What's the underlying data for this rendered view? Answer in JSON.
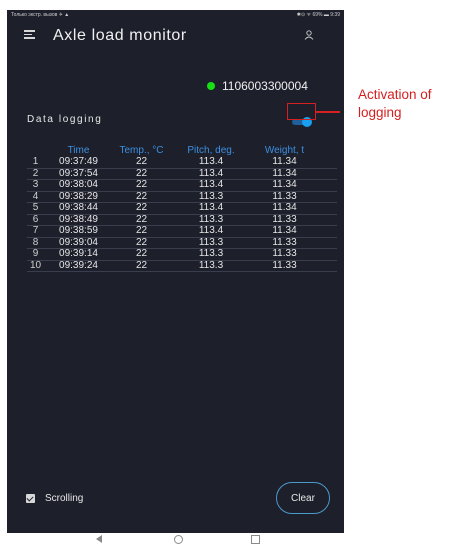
{
  "status_bar": {
    "left_text": "Только экстр. вызов ✈ ▲",
    "right_text": "✱⊙ ᯤ 69% ▬ 9:39"
  },
  "app_bar": {
    "title": "Axle load monitor",
    "menu_icon": "menu-icon",
    "user_icon": "user-icon"
  },
  "device": {
    "id": "1106003300004",
    "status_color": "#14e014"
  },
  "logging": {
    "label": "Data logging",
    "enabled": true,
    "accent_color": "#1aa0f0"
  },
  "table": {
    "columns": [
      "",
      "Time",
      "Temp., °C",
      "Pitch, deg.",
      "Weight, t"
    ],
    "rows": [
      [
        "1",
        "09:37:49",
        "22",
        "113.4",
        "11.34"
      ],
      [
        "2",
        "09:37:54",
        "22",
        "113.4",
        "11.34"
      ],
      [
        "3",
        "09:38:04",
        "22",
        "113.4",
        "11.34"
      ],
      [
        "4",
        "09:38:29",
        "22",
        "113.3",
        "11.33"
      ],
      [
        "5",
        "09:38:44",
        "22",
        "113.4",
        "11.34"
      ],
      [
        "6",
        "09:38:49",
        "22",
        "113.3",
        "11.33"
      ],
      [
        "7",
        "09:38:59",
        "22",
        "113.4",
        "11.34"
      ],
      [
        "8",
        "09:39:04",
        "22",
        "113.3",
        "11.33"
      ],
      [
        "9",
        "09:39:14",
        "22",
        "113.3",
        "11.33"
      ],
      [
        "10",
        "09:39:24",
        "22",
        "113.3",
        "11.33"
      ]
    ]
  },
  "footer": {
    "scrolling_label": "Scrolling",
    "scrolling_checked": true,
    "clear_label": "Clear"
  },
  "annotation": {
    "line1": "Activation of",
    "line2": "logging",
    "color": "#d42020"
  }
}
